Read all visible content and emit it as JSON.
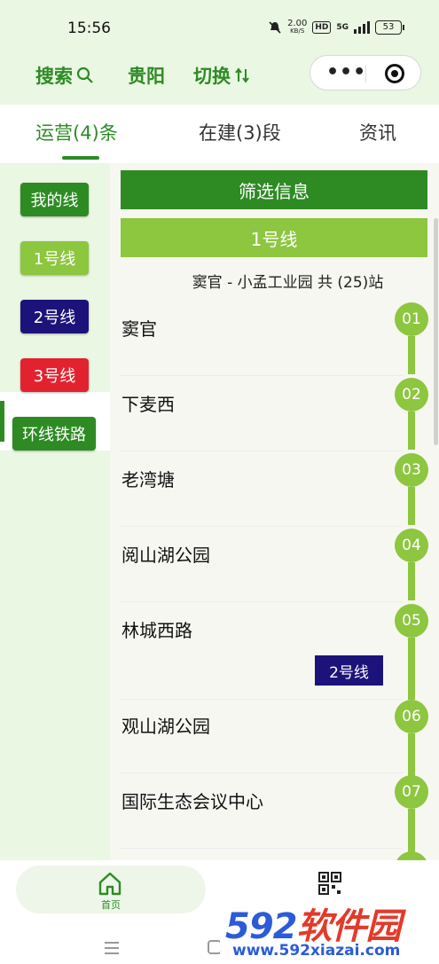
{
  "status_bar": {
    "time": "15:56",
    "net_speed": "2.00",
    "net_unit": "KB/S",
    "hd": "HD",
    "signal": "5G",
    "battery": "53"
  },
  "header": {
    "search_label": "搜索",
    "city": "贵阳",
    "switch_label": "切换"
  },
  "tabs": [
    {
      "label": "运营(4)条",
      "active": true
    },
    {
      "label": "在建(3)段",
      "active": false
    },
    {
      "label": "资讯",
      "active": false
    }
  ],
  "sidebar": {
    "items": [
      {
        "label": "我的线",
        "color": "#2e8b24"
      },
      {
        "label": "1号线",
        "color": "#8dc63f",
        "active": true
      },
      {
        "label": "2号线",
        "color": "#1c137a"
      },
      {
        "label": "3号线",
        "color": "#e2232f"
      },
      {
        "label": "环线铁路",
        "color": "#2e8b24"
      }
    ]
  },
  "main": {
    "filter_label": "筛选信息",
    "line_label": "1号线",
    "line_color": "#8dc63f",
    "route": "窦官 - 小孟工业园 共 (25)站",
    "stations": [
      {
        "num": "01",
        "name": "窦官"
      },
      {
        "num": "02",
        "name": "下麦西"
      },
      {
        "num": "03",
        "name": "老湾塘"
      },
      {
        "num": "04",
        "name": "阅山湖公园"
      },
      {
        "num": "05",
        "name": "林城西路",
        "transfer": "2号线"
      },
      {
        "num": "06",
        "name": "观山湖公园"
      },
      {
        "num": "07",
        "name": "国际生态会议中心"
      }
    ]
  },
  "bottom_nav": {
    "home_label": "首页"
  },
  "watermark": {
    "logo_num": "592",
    "logo_cn": "软件园",
    "url": "www.592xiazai.com"
  },
  "colors": {
    "primary_green": "#2e8b24",
    "light_green": "#8dc63f",
    "navy": "#1c137a",
    "red": "#e2232f"
  }
}
